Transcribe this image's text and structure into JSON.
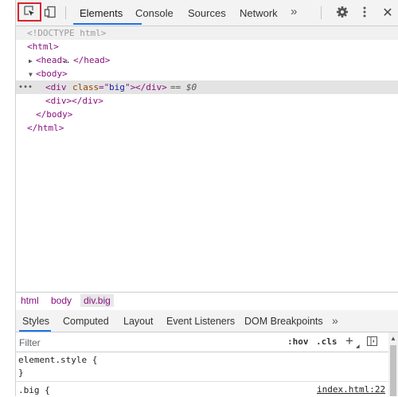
{
  "toolbar": {
    "icons": [
      "inspect-element-icon",
      "device-toolbar-icon",
      "gear-icon",
      "kebab-menu-icon",
      "close-icon"
    ],
    "tabs": [
      {
        "label": "Elements",
        "active": true
      },
      {
        "label": "Console",
        "active": false
      },
      {
        "label": "Sources",
        "active": false
      },
      {
        "label": "Network",
        "active": false
      }
    ],
    "more": "»",
    "close": "✕",
    "accent_color": "#1a73e8",
    "inspect_highlight_color": "#d9232e"
  },
  "dom_tree": {
    "doctype": "<!DOCTYPE html>",
    "html_open": "<html>",
    "head_open": "<head>",
    "head_ellipsis": "…",
    "head_close": "</head>",
    "body_open": "<body>",
    "div_open_tag": "<div",
    "div_attr_name": "class",
    "div_attr_eq": "=\"",
    "div_attr_value": "big",
    "div_attr_close": "\">",
    "div_close": "</div>",
    "selected_marker": "== $0",
    "div2": "<div></div>",
    "body_close": "</body>",
    "html_close": "</html>",
    "selected_bg": "#e3e3e3"
  },
  "breadcrumbs": [
    {
      "label": "html",
      "active": false
    },
    {
      "label": "body",
      "active": false
    },
    {
      "label": "div.big",
      "active": true
    }
  ],
  "styles_tabs": [
    {
      "label": "Styles",
      "active": true
    },
    {
      "label": "Computed",
      "active": false
    },
    {
      "label": "Layout",
      "active": false
    },
    {
      "label": "Event Listeners",
      "active": false
    },
    {
      "label": "DOM Breakpoints",
      "active": false
    }
  ],
  "styles_more": "»",
  "filter": {
    "placeholder": "Filter",
    "hov": ":hov",
    "cls": ".cls",
    "plus": "+"
  },
  "rules": {
    "element_style_open": "element.style {",
    "element_style_close": "}",
    "big_selector": ".big {",
    "source": "index.html:22"
  }
}
